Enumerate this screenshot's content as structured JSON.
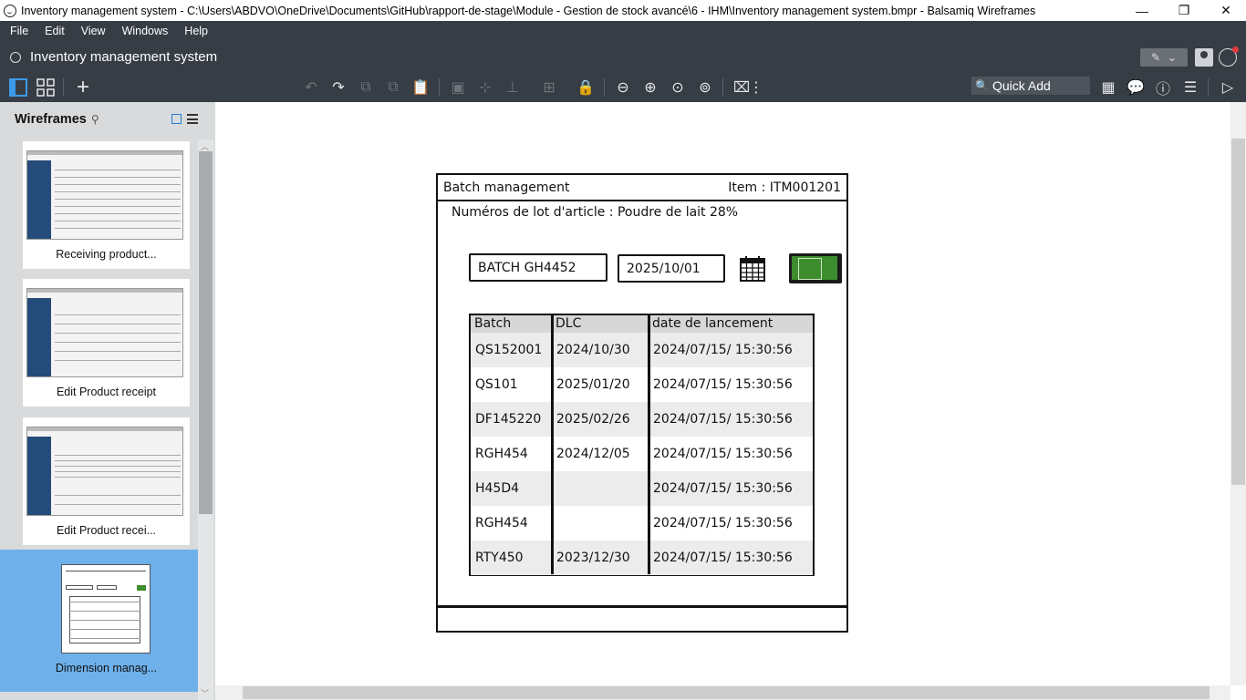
{
  "window": {
    "title": "Inventory management system - C:\\Users\\ABDVO\\OneDrive\\Documents\\GitHub\\rapport-de-stage\\Module - Gestion de stock avancé\\6 - IHM\\Inventory management system.bmpr - Balsamiq Wireframes",
    "minimize": "—",
    "restore": "❐",
    "close": "✕"
  },
  "menu": [
    "File",
    "Edit",
    "View",
    "Windows",
    "Help"
  ],
  "project": {
    "title": "Inventory management system"
  },
  "toolbar": {
    "quick_add_placeholder": "Quick Add",
    "search_glyph": "🔍"
  },
  "sidebar": {
    "title": "Wireframes",
    "thumbnails": [
      {
        "label": "Receiving product..."
      },
      {
        "label": "Edit Product receipt"
      },
      {
        "label": "Edit Product recei..."
      },
      {
        "label": "Dimension manag..."
      }
    ]
  },
  "wireframe": {
    "title": "Batch management",
    "item_label": "Item : ITM001201",
    "subtitle": "Numéros de lot d'article : Poudre de lait 28%",
    "batch_input": "BATCH GH4452",
    "date_input": "2025/10/01",
    "table": {
      "headers": [
        "Batch",
        "DLC",
        "date de lancement"
      ],
      "rows": [
        [
          "QS152001",
          "2024/10/30",
          "2024/07/15/ 15:30:56"
        ],
        [
          "QS101",
          "2025/01/20",
          "2024/07/15/ 15:30:56"
        ],
        [
          "DF145220",
          "2025/02/26",
          "2024/07/15/ 15:30:56"
        ],
        [
          "RGH454",
          "2024/12/05",
          "2024/07/15/ 15:30:56"
        ],
        [
          "H45D4",
          "",
          "2024/07/15/ 15:30:56"
        ],
        [
          "RGH454",
          "",
          "2024/07/15/ 15:30:56"
        ],
        [
          "RTY450",
          "2023/12/30",
          "2024/07/15/ 15:30:56"
        ]
      ]
    }
  }
}
